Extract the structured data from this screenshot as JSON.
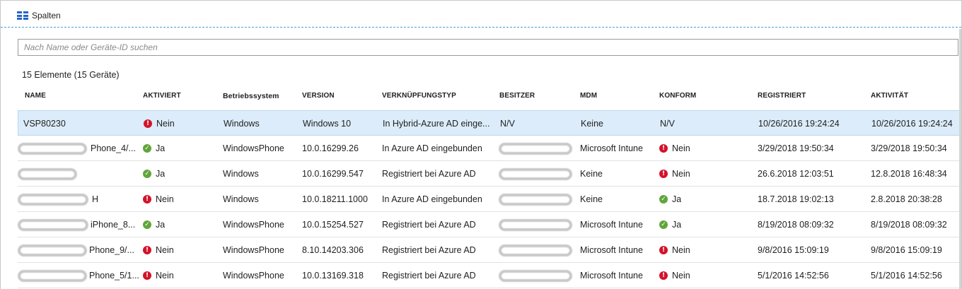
{
  "toolbar": {
    "columns_label": "Spalten"
  },
  "search": {
    "placeholder": "Nach Name oder Geräte-ID suchen"
  },
  "summary": "15 Elemente (15 Geräte)",
  "columns": [
    "NAME",
    "AKTIVIERT",
    "Betriebssystem",
    "VERSION",
    "VERKNÜPFUNGSTYP",
    "BESITZER",
    "MDM",
    "KONFORM",
    "REGISTRIERT",
    "AKTIVITÄT"
  ],
  "colors": {
    "selected_row": "#dcecfa",
    "accent": "#2566c4",
    "status_no": "#d3132b",
    "status_yes": "#61a53a"
  },
  "rows": [
    {
      "name": "VSP80230",
      "enabled": "Nein",
      "enabled_status": "no",
      "os": "Windows",
      "version": "Windows 10",
      "join_type": "In Hybrid-Azure AD einge...",
      "owner": "N/V",
      "mdm": "Keine",
      "compliant": "N/V",
      "compliant_status": "",
      "registered": "10/26/2016 19:24:24",
      "activity": "10/26/2016 19:24:24",
      "selected": true
    },
    {
      "name": "Phone_4/...",
      "enabled": "Ja",
      "enabled_status": "yes",
      "os": "WindowsPhone",
      "version": "10.0.16299.26",
      "join_type": "In Azure AD eingebunden",
      "owner": "",
      "mdm": "Microsoft Intune",
      "compliant": "Nein",
      "compliant_status": "no",
      "registered": "3/29/2018 19:50:34",
      "activity": "3/29/2018 19:50:34",
      "selected": false
    },
    {
      "name": "",
      "enabled": "Ja",
      "enabled_status": "yes",
      "os": "Windows",
      "version": "10.0.16299.547",
      "join_type": "Registriert bei Azure AD",
      "owner": "",
      "mdm": "Keine",
      "compliant": "Nein",
      "compliant_status": "no",
      "registered": "26.6.2018 12:03:51",
      "activity": "12.8.2018 16:48:34",
      "selected": false
    },
    {
      "name": "H",
      "enabled": "Nein",
      "enabled_status": "no",
      "os": "Windows",
      "version": "10.0.18211.1000",
      "join_type": "In Azure AD eingebunden",
      "owner": "",
      "mdm": "Keine",
      "compliant": "Ja",
      "compliant_status": "yes",
      "registered": "18.7.2018 19:02:13",
      "activity": "2.8.2018 20:38:28",
      "selected": false
    },
    {
      "name": "iPhone_8...",
      "enabled": "Ja",
      "enabled_status": "yes",
      "os": "WindowsPhone",
      "version": "10.0.15254.527",
      "join_type": "Registriert bei Azure AD",
      "owner": "",
      "mdm": "Microsoft Intune",
      "compliant": "Ja",
      "compliant_status": "yes",
      "registered": "8/19/2018 08:09:32",
      "activity": "8/19/2018 08:09:32",
      "selected": false
    },
    {
      "name": "Phone_9/...",
      "enabled": "Nein",
      "enabled_status": "no",
      "os": "WindowsPhone",
      "version": "8.10.14203.306",
      "join_type": "Registriert bei Azure AD",
      "owner": "",
      "mdm": "Microsoft Intune",
      "compliant": "Nein",
      "compliant_status": "no",
      "registered": "9/8/2016 15:09:19",
      "activity": "9/8/2016 15:09:19",
      "selected": false
    },
    {
      "name": "Phone_5/1...",
      "enabled": "Nein",
      "enabled_status": "no",
      "os": "WindowsPhone",
      "version": "10.0.13169.318",
      "join_type": "Registriert bei Azure AD",
      "owner": "",
      "mdm": "Microsoft Intune",
      "compliant": "Nein",
      "compliant_status": "no",
      "registered": "5/1/2016 14:52:56",
      "activity": "5/1/2016 14:52:56",
      "selected": false
    }
  ]
}
